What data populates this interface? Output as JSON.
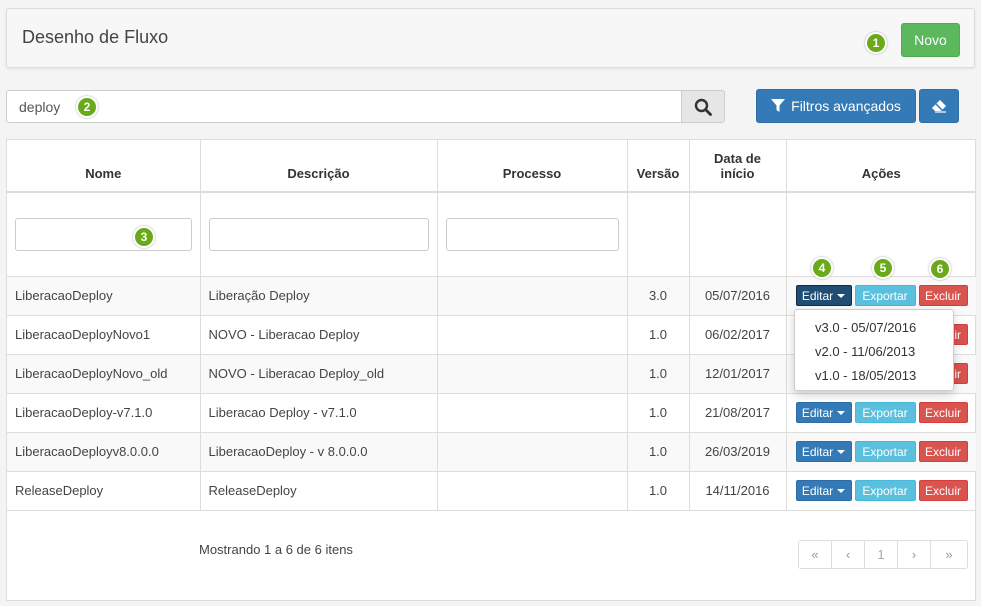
{
  "header": {
    "title": "Desenho de Fluxo",
    "new_button": "Novo"
  },
  "search": {
    "value": "deploy",
    "placeholder": "",
    "advanced_filters_label": "Filtros avançados"
  },
  "badges": [
    "1",
    "2",
    "3",
    "4",
    "5",
    "6"
  ],
  "table": {
    "columns": {
      "nome": "Nome",
      "descricao": "Descrição",
      "processo": "Processo",
      "versao": "Versão",
      "data_inicio_line1": "Data de",
      "data_inicio_line2": "início",
      "acoes": "Ações"
    },
    "rows": [
      {
        "nome": "LiberacaoDeploy",
        "descricao": "Liberação Deploy",
        "processo": "",
        "versao": "3.0",
        "data": "05/07/2016"
      },
      {
        "nome": "LiberacaoDeployNovo1",
        "descricao": "NOVO - Liberacao Deploy",
        "processo": "",
        "versao": "1.0",
        "data": "06/02/2017"
      },
      {
        "nome": "LiberacaoDeployNovo_old",
        "descricao": "NOVO - Liberacao Deploy_old",
        "processo": "",
        "versao": "1.0",
        "data": "12/01/2017"
      },
      {
        "nome": "LiberacaoDeploy-v7.1.0",
        "descricao": "Liberacao Deploy - v7.1.0",
        "processo": "",
        "versao": "1.0",
        "data": "21/08/2017"
      },
      {
        "nome": "LiberacaoDeployv8.0.0.0",
        "descricao": "LiberacaoDeploy - v 8.0.0.0",
        "processo": "",
        "versao": "1.0",
        "data": "26/03/2019"
      },
      {
        "nome": "ReleaseDeploy",
        "descricao": "ReleaseDeploy",
        "processo": "",
        "versao": "1.0",
        "data": "14/11/2016"
      }
    ],
    "actions": {
      "edit": "Editar",
      "export": "Exportar",
      "delete": "Excluir"
    }
  },
  "version_dropdown": {
    "items": [
      "v3.0 - 05/07/2016",
      "v2.0 - 11/06/2013",
      "v1.0 - 18/05/2013"
    ]
  },
  "footer": {
    "showing": "Mostrando 1 a 6 de 6 itens",
    "pagination": {
      "first": "«",
      "prev": "‹",
      "current": "1",
      "next": "›",
      "last": "»"
    }
  },
  "colors": {
    "success": "#5cb85c",
    "primary": "#337ab7",
    "primary_active": "#204d74",
    "info": "#5bc0de",
    "danger": "#d9534f",
    "badge": "#6aaa1a"
  }
}
